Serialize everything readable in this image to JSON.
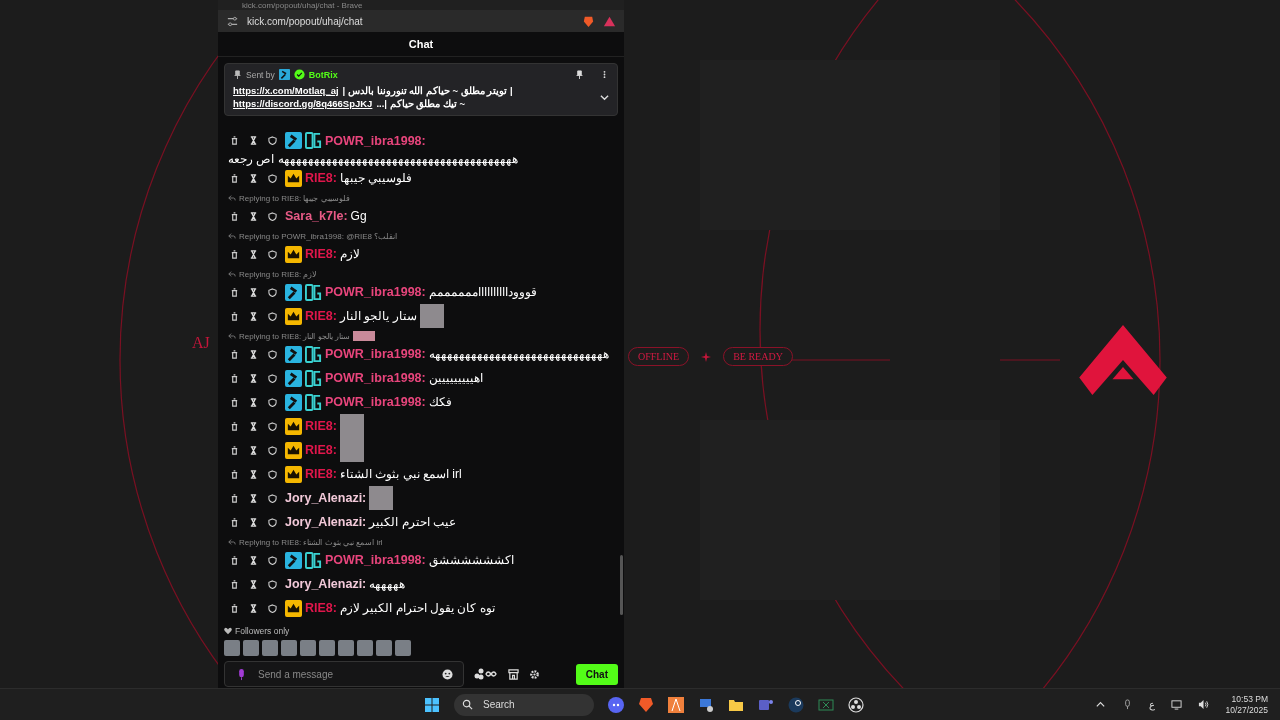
{
  "wallpaper": {
    "corner_text": "AJ",
    "status": "OFFLINE",
    "tagline": "BE READY"
  },
  "browser": {
    "title": "kick.com/popout/uhaj/chat - Brave",
    "url": "kick.com/popout/uhaj/chat"
  },
  "chat": {
    "header": "Chat",
    "pinned": {
      "sent_by": "Sent by",
      "sender": "BotRix",
      "lines": [
        {
          "link": "https://x.com/Motlaq_aj",
          "text": "| تويتر مطلق ~ حياكم الله تنوروننا بالدس |"
        },
        {
          "link": "https://discord.gg/8q466SpJKJ",
          "text": "~ تيك مطلق حياكم |..."
        }
      ]
    },
    "messages": [
      {
        "user": "POWR_ibra1998:",
        "color": "#e8457c",
        "badges": [
          {
            "kind": "mod"
          },
          {
            "kind": "og"
          }
        ],
        "text": "هههههههههههههههههههههههههههههههههههههههه اص رجعه"
      },
      {
        "user": "RIE8:",
        "color": "#e0164b",
        "badges": [
          {
            "kind": "crown"
          }
        ],
        "text": "فلوسيبي جيبها"
      },
      {
        "reply": "Replying to RIE8: فلوسيبي جيبها",
        "user": "Sara_k7le:",
        "color": "#e85a86",
        "text": "Gg"
      },
      {
        "reply": "Replying to POWR_ibra1998: @RIE8 انقلب؟",
        "user": "RIE8:",
        "color": "#e0164b",
        "badges": [
          {
            "kind": "crown"
          }
        ],
        "text": "لازم"
      },
      {
        "reply": "Replying to RIE8: لازم",
        "user": "POWR_ibra1998:",
        "color": "#e8457c",
        "badges": [
          {
            "kind": "mod"
          },
          {
            "kind": "og"
          }
        ],
        "text": "قووودااااااااااممممممم"
      },
      {
        "user": "RIE8:",
        "color": "#e0164b",
        "badges": [
          {
            "kind": "crown"
          }
        ],
        "text": "ستار يالجو النار",
        "emote": true
      },
      {
        "reply": "Replying to RIE8: ستار يالجو النار",
        "reply_emote": true,
        "user": "POWR_ibra1998:",
        "color": "#e8457c",
        "badges": [
          {
            "kind": "mod"
          },
          {
            "kind": "og"
          }
        ],
        "text": "هههههههههههههههههههههههههههههه"
      },
      {
        "user": "POWR_ibra1998:",
        "color": "#e8457c",
        "badges": [
          {
            "kind": "mod"
          },
          {
            "kind": "og"
          }
        ],
        "text": "اهييييييييين"
      },
      {
        "user": "POWR_ibra1998:",
        "color": "#e8457c",
        "badges": [
          {
            "kind": "mod"
          },
          {
            "kind": "og"
          }
        ],
        "text": "فكك"
      },
      {
        "user": "RIE8:",
        "color": "#e0164b",
        "badges": [
          {
            "kind": "crown"
          }
        ],
        "emote": true
      },
      {
        "user": "RIE8:",
        "color": "#e0164b",
        "badges": [
          {
            "kind": "crown"
          }
        ],
        "emote": true
      },
      {
        "user": "RIE8:",
        "color": "#e0164b",
        "badges": [
          {
            "kind": "crown"
          }
        ],
        "text": "اسمع نبي بثوث الشتاء irl"
      },
      {
        "user": "Jory_Alenazi:",
        "color": "#f2c9d9",
        "emote": true
      },
      {
        "user": "Jory_Alenazi:",
        "color": "#f2c9d9",
        "text": "عيب احترم الكبير"
      },
      {
        "reply": "Replying to RIE8: اسمع نبي بثوث الشتاء irl",
        "user": "POWR_ibra1998:",
        "color": "#e8457c",
        "badges": [
          {
            "kind": "mod"
          },
          {
            "kind": "og"
          }
        ],
        "text": "اكششششششق"
      },
      {
        "user": "Jory_Alenazi:",
        "color": "#f2c9d9",
        "text": "هههههه"
      },
      {
        "user": "RIE8:",
        "color": "#e0164b",
        "badges": [
          {
            "kind": "crown"
          }
        ],
        "text": "توه كان يقول احترام الكبير لازم"
      }
    ],
    "mode": "Followers only",
    "input": {
      "placeholder": "Send a message"
    },
    "send_button": "Chat"
  },
  "taskbar": {
    "search": {
      "placeholder": "Search"
    },
    "language": "ع",
    "time": "10:53 PM",
    "date": "10/27/2025"
  }
}
